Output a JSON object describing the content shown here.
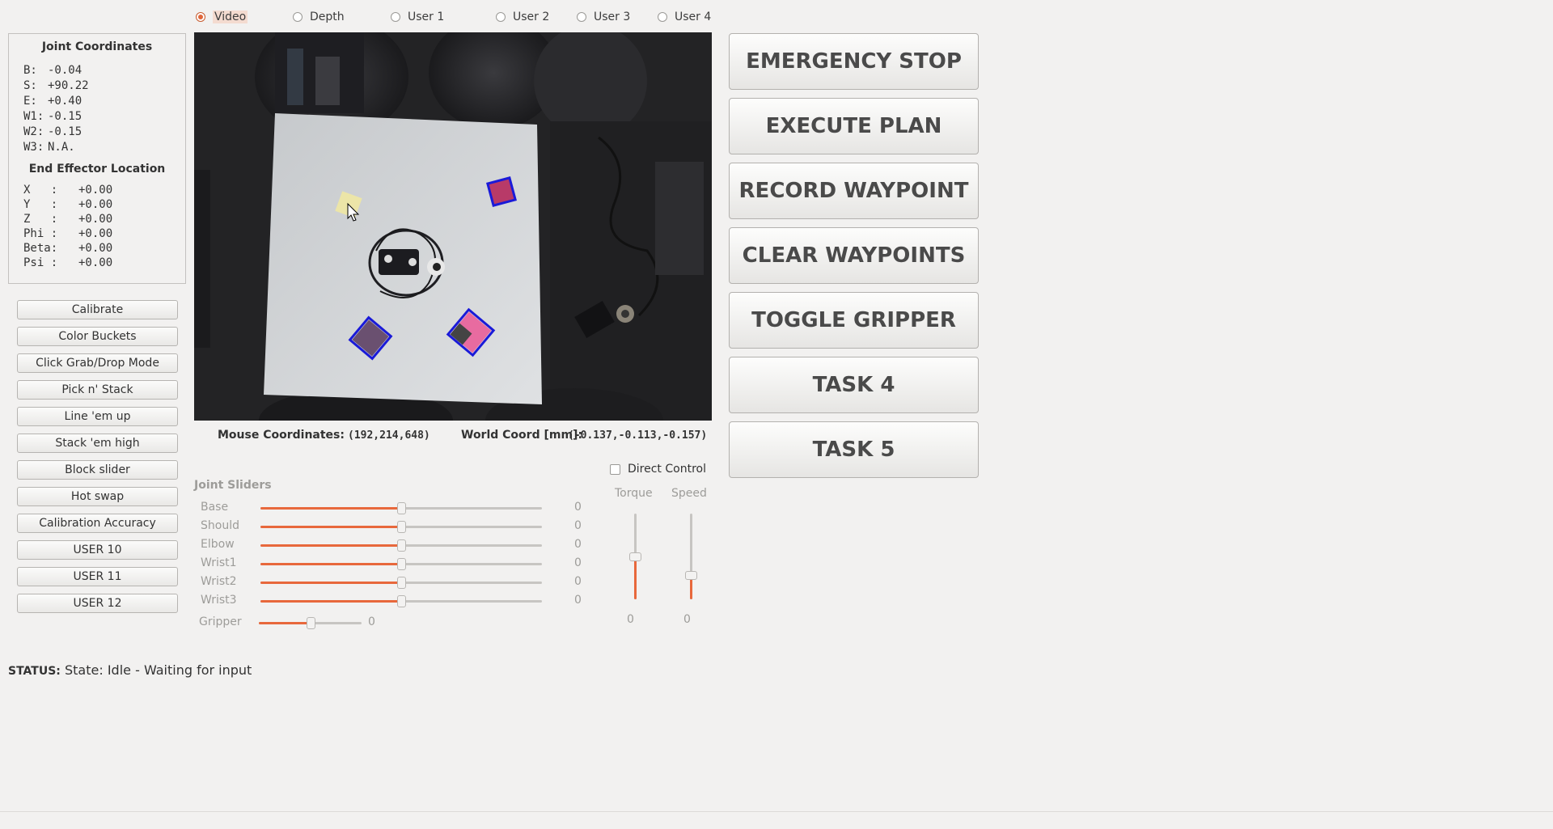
{
  "view_modes": [
    {
      "label": "Video",
      "checked": true
    },
    {
      "label": "Depth",
      "checked": false
    },
    {
      "label": "User 1",
      "checked": false
    },
    {
      "label": "User 2",
      "checked": false
    },
    {
      "label": "User 3",
      "checked": false
    },
    {
      "label": "User 4",
      "checked": false
    }
  ],
  "joint_coordinates": {
    "title": "Joint Coordinates",
    "rows": [
      {
        "label": "B:",
        "value": "-0.04"
      },
      {
        "label": "S:",
        "value": "+90.22"
      },
      {
        "label": "E:",
        "value": "+0.40"
      },
      {
        "label": "W1:",
        "value": "-0.15"
      },
      {
        "label": "W2:",
        "value": "-0.15"
      },
      {
        "label": "W3:",
        "value": "N.A."
      }
    ]
  },
  "end_effector": {
    "title": "End Effector Location",
    "rows": [
      {
        "label": "X   :",
        "value": "+0.00"
      },
      {
        "label": "Y   :",
        "value": "+0.00"
      },
      {
        "label": "Z   :",
        "value": "+0.00"
      },
      {
        "label": "Phi :",
        "value": "+0.00"
      },
      {
        "label": "Beta:",
        "value": "+0.00"
      },
      {
        "label": "Psi :",
        "value": "+0.00"
      }
    ]
  },
  "left_buttons": [
    "Calibrate",
    "Color Buckets",
    "Click Grab/Drop Mode",
    "Pick n' Stack",
    "Line 'em up",
    "Stack 'em high",
    "Block slider",
    "Hot swap",
    "Calibration Accuracy",
    "USER 10",
    "USER 11",
    "USER 12"
  ],
  "big_buttons": [
    "EMERGENCY STOP",
    "EXECUTE PLAN",
    "RECORD WAYPOINT",
    "CLEAR WAYPOINTS",
    "TOGGLE GRIPPER",
    "TASK 4",
    "TASK 5"
  ],
  "coords": {
    "mouse_label": "Mouse Coordinates:",
    "mouse_value": "(192,214,648)",
    "world_label": "World Coord [mm]:",
    "world_value": "(-0.137,-0.113,-0.157)"
  },
  "direct_control": {
    "label": "Direct Control",
    "checked": false
  },
  "joint_sliders": {
    "title": "Joint Sliders",
    "rows": [
      {
        "label": "Base",
        "value": "0",
        "fraction": 0.5
      },
      {
        "label": "Should",
        "value": "0",
        "fraction": 0.5
      },
      {
        "label": "Elbow",
        "value": "0",
        "fraction": 0.5
      },
      {
        "label": "Wrist1",
        "value": "0",
        "fraction": 0.5
      },
      {
        "label": "Wrist2",
        "value": "0",
        "fraction": 0.5
      },
      {
        "label": "Wrist3",
        "value": "0",
        "fraction": 0.5
      }
    ],
    "gripper": {
      "label": "Gripper",
      "value": "0",
      "fraction": 0.5
    }
  },
  "vertical_sliders": [
    {
      "label": "Torque",
      "value": "0",
      "fraction": 0.5
    },
    {
      "label": "Speed",
      "value": "0",
      "fraction": 0.28
    }
  ],
  "status": {
    "label": "STATUS:",
    "text": "State: Idle - Waiting for input"
  },
  "colors": {
    "accent": "#e8683c",
    "background": "#f2f1f0"
  }
}
